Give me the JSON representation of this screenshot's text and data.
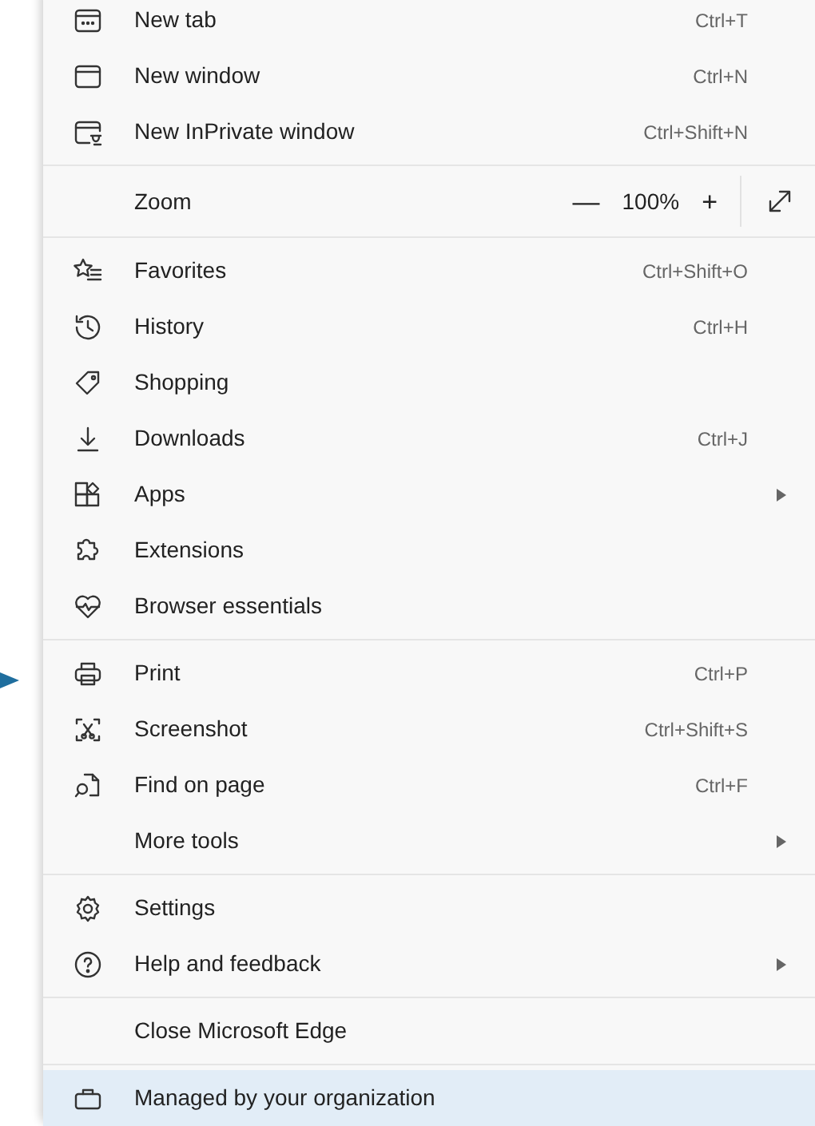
{
  "pointer_arrow": true,
  "menu": {
    "sections": [
      {
        "items": [
          {
            "kind": "command",
            "label": "New tab",
            "shortcut": "Ctrl+T",
            "submenu": false,
            "selected": false
          },
          {
            "kind": "command",
            "label": "New window",
            "shortcut": "Ctrl+N",
            "submenu": false,
            "selected": false
          },
          {
            "kind": "command",
            "label": "New InPrivate window",
            "shortcut": "Ctrl+Shift+N",
            "submenu": false,
            "selected": false
          }
        ]
      },
      {
        "items": [
          {
            "kind": "zoom",
            "label": "Zoom",
            "minus": "—",
            "value": "100%",
            "plus": "+",
            "selected": false
          }
        ]
      },
      {
        "items": [
          {
            "kind": "command",
            "label": "Favorites",
            "shortcut": "Ctrl+Shift+O",
            "submenu": false,
            "selected": false
          },
          {
            "kind": "command",
            "label": "History",
            "shortcut": "Ctrl+H",
            "submenu": false,
            "selected": false
          },
          {
            "kind": "command",
            "label": "Shopping",
            "submenu": false,
            "selected": false
          },
          {
            "kind": "command",
            "label": "Downloads",
            "shortcut": "Ctrl+J",
            "submenu": false,
            "selected": false
          },
          {
            "kind": "command",
            "label": "Apps",
            "submenu": true,
            "selected": false
          },
          {
            "kind": "command",
            "label": "Extensions",
            "submenu": false,
            "selected": false
          },
          {
            "kind": "command",
            "label": "Browser essentials",
            "submenu": false,
            "selected": false
          }
        ]
      },
      {
        "items": [
          {
            "kind": "command",
            "label": "Print",
            "shortcut": "Ctrl+P",
            "submenu": false,
            "selected": false
          },
          {
            "kind": "command",
            "label": "Screenshot",
            "shortcut": "Ctrl+Shift+S",
            "submenu": false,
            "selected": false
          },
          {
            "kind": "command",
            "label": "Find on page",
            "shortcut": "Ctrl+F",
            "submenu": false,
            "selected": false
          },
          {
            "kind": "command",
            "label": "More tools",
            "submenu": true,
            "selected": false
          }
        ]
      },
      {
        "items": [
          {
            "kind": "command",
            "label": "Settings",
            "submenu": false,
            "selected": false
          },
          {
            "kind": "command",
            "label": "Help and feedback",
            "submenu": true,
            "selected": false
          }
        ]
      },
      {
        "items": [
          {
            "kind": "command",
            "label": "Close Microsoft Edge",
            "submenu": false,
            "selected": false
          }
        ]
      },
      {
        "items": [
          {
            "kind": "command",
            "label": "Managed by your organization",
            "submenu": false,
            "selected": true
          }
        ]
      }
    ]
  }
}
